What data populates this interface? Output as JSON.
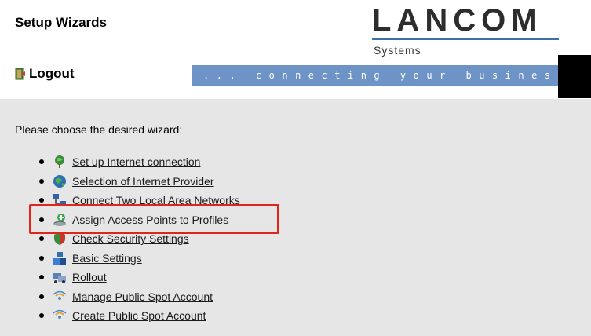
{
  "header": {
    "title": "Setup Wizards",
    "logout_label": "Logout",
    "logo_text": "LANCOM",
    "logo_sub": "Systems",
    "tagline": "... connecting your business"
  },
  "main": {
    "prompt": "Please choose the desired wizard:",
    "wizards": [
      {
        "label": "Set up Internet connection",
        "icon": "globe-plant-icon"
      },
      {
        "label": "Selection of Internet Provider",
        "icon": "globe-icon"
      },
      {
        "label": "Connect Two Local Area Networks",
        "icon": "network-icon"
      },
      {
        "label": "Assign Access Points to Profiles",
        "icon": "access-point-add-icon"
      },
      {
        "label": "Check Security Settings",
        "icon": "shield-icon"
      },
      {
        "label": "Basic Settings",
        "icon": "blocks-icon"
      },
      {
        "label": "Rollout",
        "icon": "rollout-icon"
      },
      {
        "label": "Manage Public Spot Account",
        "icon": "wireless-icon"
      },
      {
        "label": "Create Public Spot Account",
        "icon": "wireless-icon"
      }
    ],
    "highlighted_item": "Assign Access Points to Profiles"
  },
  "colors": {
    "tagline_bg": "#6e93c6",
    "content_bg": "#e6e6e6",
    "highlight": "#e0261b"
  }
}
